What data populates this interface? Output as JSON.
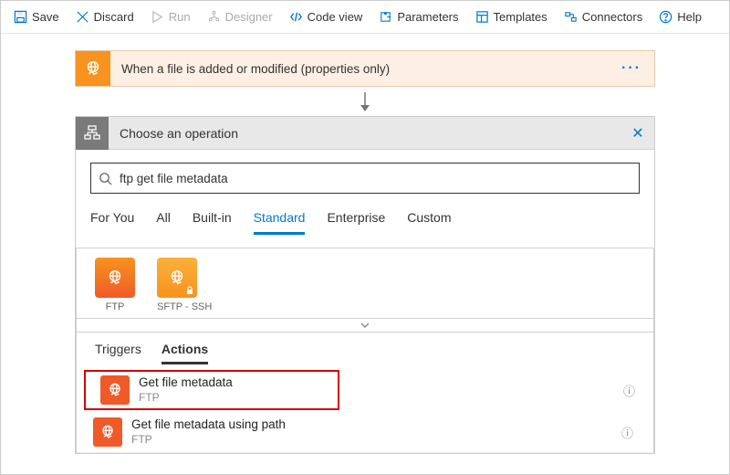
{
  "toolbar": {
    "save": "Save",
    "discard": "Discard",
    "run": "Run",
    "designer": "Designer",
    "code_view": "Code view",
    "parameters": "Parameters",
    "templates": "Templates",
    "connectors": "Connectors",
    "help": "Help"
  },
  "trigger": {
    "title": "When a file is added or modified (properties only)"
  },
  "panel": {
    "title": "Choose an operation",
    "search_value": "ftp get file metadata"
  },
  "category_tabs": [
    "For You",
    "All",
    "Built-in",
    "Standard",
    "Enterprise",
    "Custom"
  ],
  "category_active_index": 3,
  "connectors_list": [
    {
      "label": "FTP",
      "color": "orange"
    },
    {
      "label": "SFTP - SSH",
      "color": "yellow"
    }
  ],
  "ta_tabs": [
    "Triggers",
    "Actions"
  ],
  "ta_active_index": 1,
  "actions_list": [
    {
      "title": "Get file metadata",
      "sub": "FTP",
      "highlight": true
    },
    {
      "title": "Get file metadata using path",
      "sub": "FTP",
      "highlight": false
    }
  ]
}
